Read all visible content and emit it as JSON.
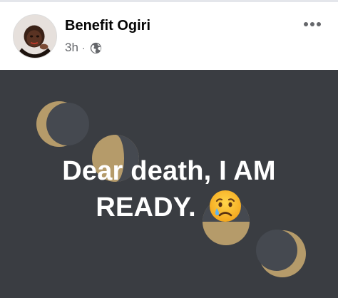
{
  "post": {
    "author": "Benefit Ogiri",
    "time": "3h",
    "separator": "·",
    "privacy_icon": "globe-icon",
    "more_icon": "more-options-icon",
    "avatar_icon": "profile-avatar",
    "status_text": "Dear death, I AM READY.",
    "emoji": "crying-face-emoji",
    "background_color": "#3a3d42",
    "decor_color": "#b59b6a"
  }
}
